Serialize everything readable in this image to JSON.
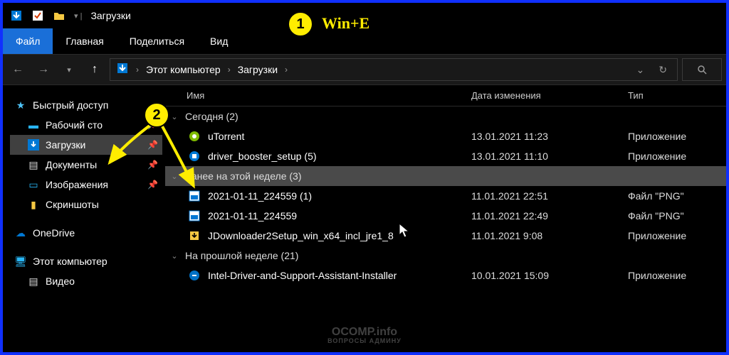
{
  "window": {
    "title": "Загрузки"
  },
  "ribbon": {
    "file": "Файл",
    "home": "Главная",
    "share": "Поделиться",
    "view": "Вид"
  },
  "breadcrumb": {
    "root": "Этот компьютер",
    "folder": "Загрузки"
  },
  "columns": {
    "name": "Имя",
    "date": "Дата изменения",
    "type": "Тип"
  },
  "sidebar": {
    "quick": "Быстрый доступ",
    "desktop": "Рабочий сто",
    "downloads": "Загрузки",
    "documents": "Документы",
    "pictures": "Изображения",
    "screenshots": "Скриншоты",
    "onedrive": "OneDrive",
    "thispc": "Этот компьютер",
    "videos": "Видео"
  },
  "groups": {
    "today": "Сегодня (2)",
    "earlier_week": "Ранее на этой неделе (3)",
    "last_week": "На прошлой неделе (21)"
  },
  "files": {
    "f1": {
      "name": "uTorrent",
      "date": "13.01.2021 11:23",
      "type": "Приложение"
    },
    "f2": {
      "name": "driver_booster_setup (5)",
      "date": "13.01.2021 11:10",
      "type": "Приложение"
    },
    "f3": {
      "name": "2021-01-11_224559 (1)",
      "date": "11.01.2021 22:51",
      "type": "Файл \"PNG\""
    },
    "f4": {
      "name": "2021-01-11_224559",
      "date": "11.01.2021 22:49",
      "type": "Файл \"PNG\""
    },
    "f5": {
      "name": "JDownloader2Setup_win_x64_incl_jre1_8",
      "date": "11.01.2021 9:08",
      "type": "Приложение"
    },
    "f6": {
      "name": "Intel-Driver-and-Support-Assistant-Installer",
      "date": "10.01.2021 15:09",
      "type": "Приложение"
    }
  },
  "annotations": {
    "b1": "1",
    "b1_label": "Win+E",
    "b2": "2"
  },
  "watermark": {
    "main": "OCOMP.info",
    "sub": "ВОПРОСЫ АДМИНУ"
  }
}
